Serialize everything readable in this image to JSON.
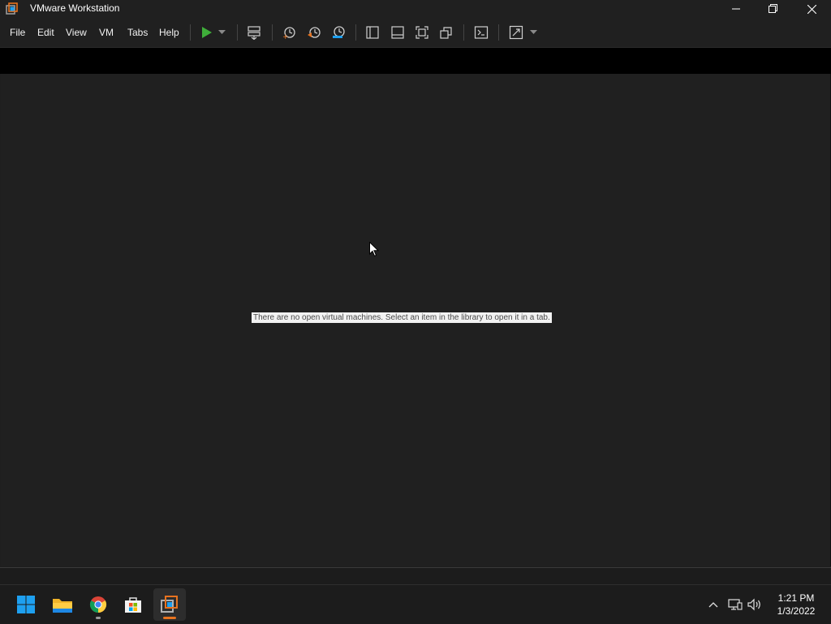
{
  "window": {
    "title": "VMware Workstation",
    "minimize_icon": "minimize-icon",
    "restore_icon": "restore-icon",
    "close_icon": "close-icon"
  },
  "menu": {
    "items": [
      "File",
      "Edit",
      "View",
      "VM",
      "Tabs",
      "Help"
    ]
  },
  "toolbar": {
    "buttons": [
      "power-on-icon",
      "dropdown-arrow-icon",
      "send-ctrl-alt-del-icon",
      "take-snapshot-icon",
      "revert-snapshot-icon",
      "snapshot-manager-icon",
      "show-library-icon",
      "show-thumbnail-bar-icon",
      "full-screen-icon",
      "unity-icon",
      "console-view-icon",
      "stretch-guest-icon",
      "stretch-dropdown-icon"
    ]
  },
  "main": {
    "empty_message": "There are no open virtual machines. Select an item in the library to open it in a tab."
  },
  "taskbar": {
    "apps": [
      "start-icon",
      "file-explorer-icon",
      "chrome-icon",
      "microsoft-store-icon",
      "vmware-workstation-icon"
    ],
    "tray": [
      "show-hidden-icons-icon",
      "network-icon",
      "volume-icon"
    ],
    "time": "1:21 PM",
    "date": "1/3/2022"
  },
  "colors": {
    "accent_green": "#3fae3a",
    "accent_orange": "#e8731f",
    "windows_blue": "#1ea0f0",
    "background": "#202020"
  }
}
